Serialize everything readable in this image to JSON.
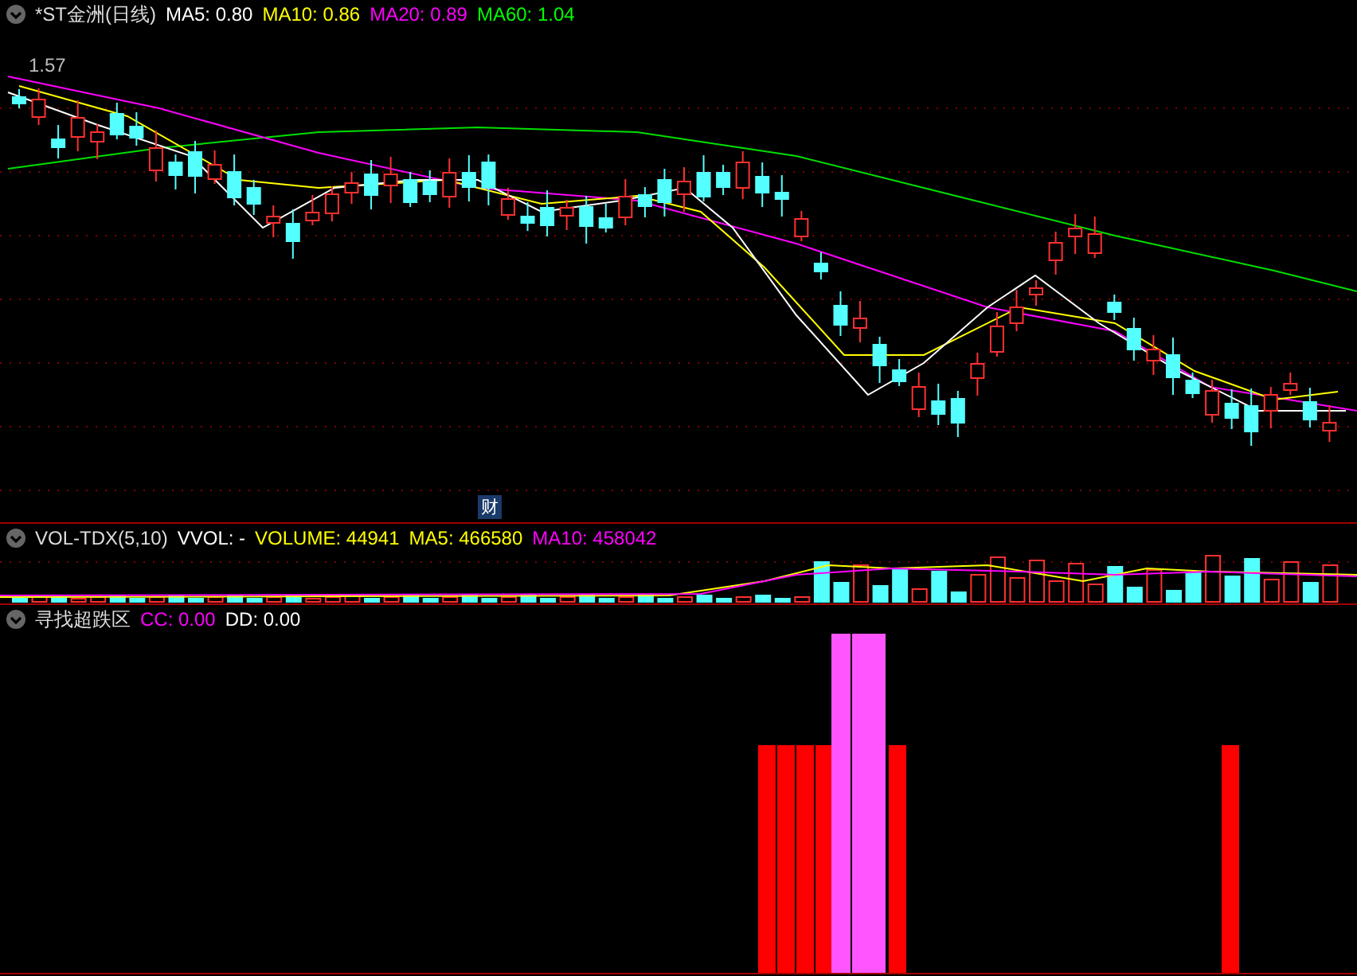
{
  "main_panel": {
    "title": "*ST金洲(日线)",
    "indicators": [
      {
        "label": "MA5: 0.80",
        "color": "#ffffff"
      },
      {
        "label": "MA10: 0.86",
        "color": "#ffff00"
      },
      {
        "label": "MA20: 0.89",
        "color": "#ff00ff"
      },
      {
        "label": "MA60: 1.04",
        "color": "#00ff00"
      }
    ],
    "price_label": "1.57",
    "event_marker": "财"
  },
  "volume_panel": {
    "title": "VOL-TDX(5,10)",
    "indicators": [
      {
        "label": "VVOL: -",
        "color": "#ffffff"
      },
      {
        "label": "VOLUME: 44941",
        "color": "#ffff00"
      },
      {
        "label": "MA5: 466580",
        "color": "#ffff00"
      },
      {
        "label": "MA10: 458042",
        "color": "#ff00ff"
      }
    ]
  },
  "signal_panel": {
    "title": "寻找超跌区",
    "indicators": [
      {
        "label": "CC: 0.00",
        "color": "#ff00ff"
      },
      {
        "label": "DD: 0.00",
        "color": "#ffffff"
      }
    ]
  }
}
